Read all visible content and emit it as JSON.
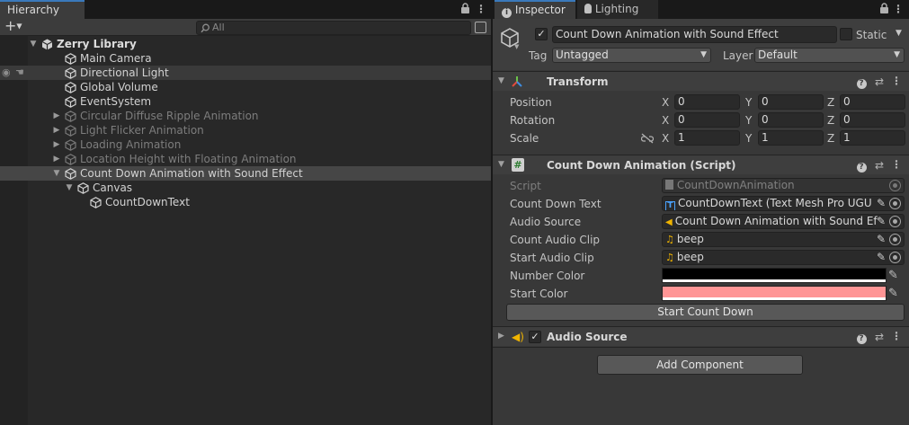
{
  "hierarchy": {
    "tab_label": "Hierarchy",
    "search_placeholder": "All",
    "add_label": "+",
    "items": [
      {
        "label": "Zerry Library",
        "depth": 0,
        "expanded": true,
        "state": "scene"
      },
      {
        "label": "Main Camera",
        "depth": 1,
        "state": "normal"
      },
      {
        "label": "Directional Light",
        "depth": 1,
        "state": "hover"
      },
      {
        "label": "Global Volume",
        "depth": 1,
        "state": "normal"
      },
      {
        "label": "EventSystem",
        "depth": 1,
        "state": "normal"
      },
      {
        "label": "Circular Diffuse Ripple Animation",
        "depth": 1,
        "collapsed": true,
        "state": "inactive"
      },
      {
        "label": "Light Flicker Animation",
        "depth": 1,
        "collapsed": true,
        "state": "inactive"
      },
      {
        "label": "Loading Animation",
        "depth": 1,
        "collapsed": true,
        "state": "inactive"
      },
      {
        "label": "Location Height with Floating Animation",
        "depth": 1,
        "collapsed": true,
        "state": "inactive"
      },
      {
        "label": "Count Down Animation with Sound Effect",
        "depth": 1,
        "expanded": true,
        "state": "selected"
      },
      {
        "label": "Canvas",
        "depth": 2,
        "expanded": true,
        "state": "normal"
      },
      {
        "label": "CountDownText",
        "depth": 3,
        "state": "normal"
      }
    ]
  },
  "inspector": {
    "tab_label": "Inspector",
    "lighting_tab_label": "Lighting",
    "object_name": "Count Down Animation with Sound Effect",
    "static_label": "Static",
    "tag_label": "Tag",
    "tag_value": "Untagged",
    "layer_label": "Layer",
    "layer_value": "Default",
    "transform": {
      "title": "Transform",
      "rows": [
        {
          "label": "Position",
          "x": "0",
          "y": "0",
          "z": "0"
        },
        {
          "label": "Rotation",
          "x": "0",
          "y": "0",
          "z": "0"
        },
        {
          "label": "Scale",
          "x": "1",
          "y": "1",
          "z": "1"
        }
      ],
      "axis_x": "X",
      "axis_y": "Y",
      "axis_z": "Z"
    },
    "script": {
      "title": "Count Down Animation (Script)",
      "script_label": "Script",
      "script_value": "CountDownAnimation",
      "fields": [
        {
          "label": "Count Down Text",
          "value": "CountDownText (Text Mesh Pro UGU",
          "icon": "text-icon"
        },
        {
          "label": "Audio Source",
          "value": "Count Down Animation with Sound Ef",
          "icon": "speaker-icon"
        },
        {
          "label": "Count Audio Clip",
          "value": "beep",
          "icon": "music-note-icon"
        },
        {
          "label": "Start Audio Clip",
          "value": "beep",
          "icon": "music-note-icon"
        }
      ],
      "number_color_label": "Number Color",
      "start_color_label": "Start Color",
      "number_color": "#000000",
      "start_color": "#ff9595",
      "button_label": "Start Count Down"
    },
    "audio_source": {
      "title": "Audio Source"
    },
    "add_component_label": "Add Component"
  },
  "colors": {
    "accent": "#3a79bb",
    "selected_row": "#464646"
  }
}
